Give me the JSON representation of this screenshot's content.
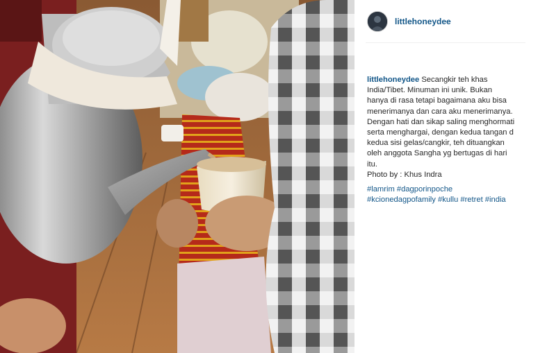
{
  "post": {
    "username": "littlehoneydee",
    "caption": {
      "username": "littlehoneydee",
      "lines": [
        "Secangkir teh khas",
        "India/Tibet. Minuman ini unik. Bukan",
        "hanya di rasa tetapi bagaimana aku bisa",
        "menerimanya dan cara aku menerimanya.",
        "Dengan hati dan sikap saling menghormati",
        "serta menghargai, dengan kedua tangan d",
        "kedua sisi gelas/cangkir, teh dituangkan",
        "oleh anggota Sangha yg bertugas di hari",
        "itu.",
        "Photo by : Khus Indra"
      ]
    },
    "hashtags": [
      [
        "#lamrim",
        "#dagporinpoche"
      ],
      [
        "#kcionedagpofamily",
        "#kullu",
        "#retret",
        "#india"
      ]
    ]
  },
  "colors": {
    "link": "#125688",
    "text": "#262626",
    "divider": "#efefef"
  }
}
